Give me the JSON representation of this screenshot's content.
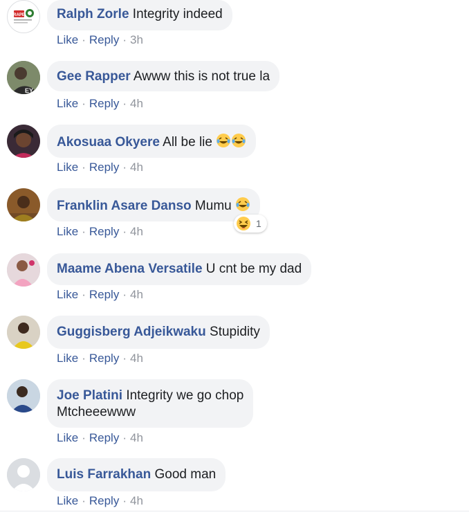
{
  "actions": {
    "like": "Like",
    "reply": "Reply",
    "separator": "·"
  },
  "comments": [
    {
      "author": "Ralph Zorle",
      "text": "Integrity indeed",
      "time": "3h",
      "avatar": "rape-logo-avatar"
    },
    {
      "author": "Gee Rapper",
      "text": "Awww this is not true la",
      "time": "4h",
      "avatar": "user-avatar"
    },
    {
      "author": "Akosuaa Okyere",
      "text": "All be lie",
      "time": "4h",
      "avatar": "user-avatar",
      "emojis": [
        "laugh-cry-emoji",
        "laugh-cry-emoji"
      ]
    },
    {
      "author": "Franklin Asare Danso",
      "text": "Mumu",
      "time": "4h",
      "avatar": "user-avatar",
      "emojis": [
        "laugh-cry-emoji"
      ],
      "reaction": {
        "type": "haha",
        "count": "1"
      }
    },
    {
      "author": "Maame Abena Versatile",
      "text": "U cnt be my dad",
      "time": "4h",
      "avatar": "user-avatar"
    },
    {
      "author": "Guggisberg Adjeikwaku",
      "text": "Stupidity",
      "time": "4h",
      "avatar": "user-avatar"
    },
    {
      "author": "Joe Platini",
      "text": "Integrity we go chop",
      "text_line2": "Mtcheeewww",
      "time": "4h",
      "avatar": "user-avatar"
    },
    {
      "author": "Luis Farrakhan",
      "text": "Good man",
      "time": "4h",
      "avatar": "default-silhouette-avatar"
    }
  ],
  "colors": {
    "author": "#385898",
    "bubble": "#f2f3f5",
    "text": "#1c1e21",
    "meta": "#90949c",
    "emoji_face": "#ffcc4d"
  }
}
